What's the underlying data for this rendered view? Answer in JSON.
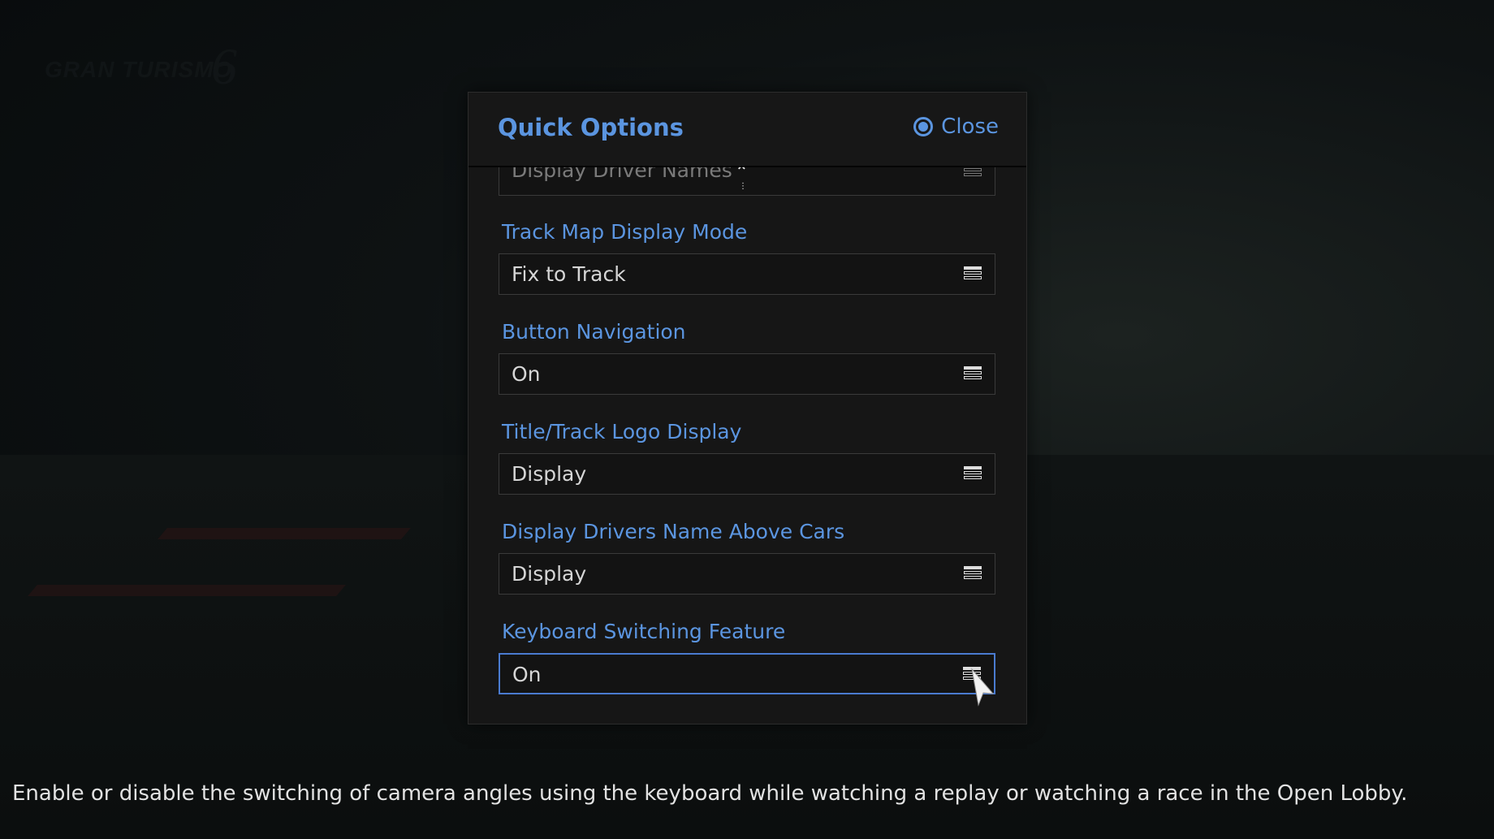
{
  "background": {
    "logo_text": "GRAN TURISMO",
    "logo_number": "6"
  },
  "dialog": {
    "title": "Quick Options",
    "close_label": "Close",
    "partial_item": {
      "value": "Display Driver Names"
    },
    "items": [
      {
        "label": "Track Map Display Mode",
        "value": "Fix to Track"
      },
      {
        "label": "Button Navigation",
        "value": "On"
      },
      {
        "label": "Title/Track Logo Display",
        "value": "Display"
      },
      {
        "label": "Display Drivers Name Above Cars",
        "value": "Display"
      },
      {
        "label": "Keyboard Switching Feature",
        "value": "On",
        "focused": true
      }
    ]
  },
  "description": "Enable or disable the switching of camera angles using the keyboard while watching a replay or watching a race in the Open Lobby.",
  "colors": {
    "accent": "#5b95e0",
    "focus_border": "#4a7bd0",
    "panel": "#161616"
  }
}
